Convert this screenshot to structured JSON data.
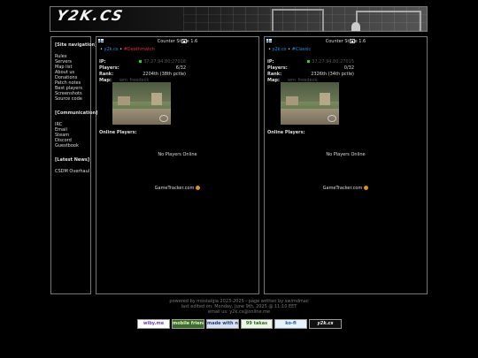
{
  "header": {
    "logo_text": "Y2K.CS"
  },
  "sidebar": {
    "nav_heading": "[Site navigation]",
    "nav_items": [
      "Rules",
      "Servers",
      "Map list",
      "About us",
      "Donations",
      "Patch notes",
      "Best players",
      "Screenshots",
      "Source code"
    ],
    "comm_heading": "[Communication]",
    "comm_items": [
      "IRC",
      "Email",
      "Steam",
      "Discord",
      "Guestbook"
    ],
    "news_heading": "[Latest News]",
    "news_items": [
      "CSDM Overhaul"
    ]
  },
  "servers": [
    {
      "title": "Counter Strike 1.6",
      "host": "y2k.cs",
      "map_label": "#Deathmatch",
      "ip_label": "IP:",
      "ip": "37.27.94.80:27016",
      "players_label": "Players:",
      "players": "6/32",
      "rank_label": "Rank:",
      "rank": "2204th (38th pctle)",
      "map_key": "Map:",
      "map": "wm_freedeck",
      "online_label": "Online Players:",
      "no_players": "No Players Online",
      "gametracker": "GameTracker.com"
    },
    {
      "title": "Counter Strike 1.6",
      "host": "y2k.cs",
      "map_label": "#Classic",
      "ip_label": "IP:",
      "ip": "37.27.94.80:27015",
      "players_label": "Players:",
      "players": "0/32",
      "rank_label": "Rank:",
      "rank": "2326th (34th pctle)",
      "map_key": "Map:",
      "map": "wm_freedeck",
      "online_label": "Online Players:",
      "no_players": "No Players Online",
      "gametracker": "GameTracker.com"
    }
  ],
  "footer": {
    "line1": "powered by mostalgia 2023-2025 - page written by swimdmac",
    "line2": "last edited on: Monday, June 9th, 2025 @ 11:10 EET",
    "line3": "email us: y2k.cs@online.me",
    "badges": [
      "wiby.me",
      "mobile friendly",
      "made with notepad",
      "99 takas",
      "ko-fi",
      "y2k.cs"
    ]
  },
  "colors": {
    "accent_blue": "#2b8fd9",
    "accent_red": "#e03030",
    "online_green": "#2fd02f",
    "border": "#777777"
  }
}
